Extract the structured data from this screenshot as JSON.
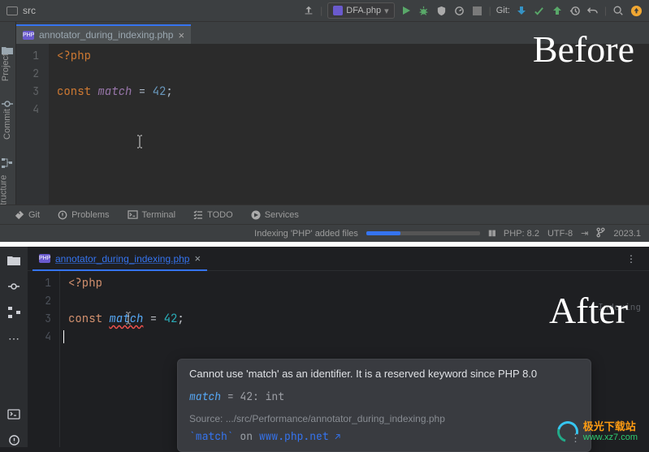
{
  "before": {
    "breadcrumb": "src",
    "run_config": {
      "file_icon": "php",
      "name": "DFA.php"
    },
    "toolbar_icons": [
      "person-icon",
      "run-icon",
      "debug-icon",
      "coverage-icon",
      "profile-icon",
      "stop-icon"
    ],
    "git_label": "Git:",
    "tab": {
      "name": "annotator_during_indexing.php"
    },
    "sidebar": {
      "project": "Project",
      "commit": "Commit",
      "structure": "Structure"
    },
    "gutter": [
      "1",
      "2",
      "3",
      "4"
    ],
    "code": {
      "l1": "<?php",
      "l3_kw": "const ",
      "l3_id": "match",
      "l3_eq": " = ",
      "l3_num": "42",
      "l3_semi": ";"
    },
    "tools": {
      "git": "Git",
      "problems": "Problems",
      "terminal": "Terminal",
      "todo": "TODO",
      "services": "Services"
    },
    "status": {
      "indexing": "Indexing 'PHP' added files",
      "php": "PHP: 8.2",
      "encoding": "UTF-8",
      "year": "2023.1"
    },
    "label": "Before"
  },
  "after": {
    "tab": {
      "name": "annotator_during_indexing.php"
    },
    "gutter": [
      "1",
      "2",
      "3",
      "4"
    ],
    "code": {
      "l1": "<?php",
      "l3_kw": "const ",
      "l3_id": "match",
      "l3_eq": " = ",
      "l3_num": "42",
      "l3_semi": ";"
    },
    "indexing": "Indexing",
    "tooltip": {
      "message": "Cannot use 'match' as an identifier. It is a reserved keyword since PHP 8.0",
      "eval_id": "match",
      "eval_eq": " = 42: ",
      "eval_type": "int",
      "source_label": "Source:  ",
      "source_path": ".../src/Performance/annotator_during_indexing.php",
      "link_code": "`match`",
      "link_on": " on ",
      "link_site": "www.php.net",
      "link_arrow": "↗"
    },
    "label": "After"
  },
  "watermark": {
    "cn": "极光下载站",
    "url": "www.xz7.com"
  }
}
